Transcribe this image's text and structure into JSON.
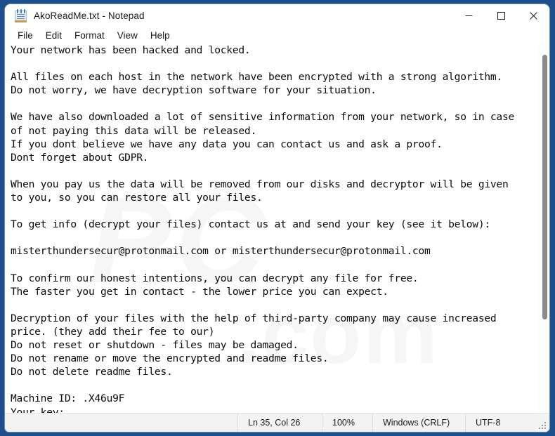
{
  "window": {
    "title": "AkoReadMe.txt - Notepad",
    "icon": "notepad-icon",
    "controls": {
      "minimize": "minimize-icon",
      "maximize": "maximize-icon",
      "close": "close-icon"
    }
  },
  "menu": {
    "items": [
      {
        "label": "File"
      },
      {
        "label": "Edit"
      },
      {
        "label": "Format"
      },
      {
        "label": "View"
      },
      {
        "label": "Help"
      }
    ]
  },
  "document": {
    "filename": "AkoReadMe.txt",
    "body": "Your network has been hacked and locked.\n\nAll files on each host in the network have been encrypted with a strong algorithm.\nDo not worry, we have decryption software for your situation.\n\nWe have also downloaded a lot of sensitive information from your network, so in case\nof not paying this data will be released.\nIf you dont believe we have any data you can contact us and ask a proof.\nDont forget about GDPR.\n\nWhen you pay us the data will be removed from our disks and decryptor will be given\nto you, so you can restore all your files.\n\nTo get info (decrypt your files) contact us at and send your key (see it below):\n\nmisterthundersecur@protonmail.com or misterthundersecur@protonmail.com\n\nTo confirm our honest intentions, you can decrypt any file for free.\nThe faster you get in contact - the lower price you can expect.\n\nDecryption of your files with the help of third-party company may cause increased\nprice. (they add their fee to our)\nDo not reset or shutdown - files may be damaged.\nDo not rename or move the encrypted and readme files.\nDo not delete readme files.\n\nMachine ID: .X46u9F\nYour key:",
    "contact_email": "misterthundersecur@protonmail.com",
    "machine_id": ".X46u9F"
  },
  "watermark": {
    "line1": "PC",
    "line2": ".com"
  },
  "status_bar": {
    "position": "Ln 35, Col 26",
    "zoom": "100%",
    "line_endings": "Windows (CRLF)",
    "encoding": "UTF-8"
  },
  "colors": {
    "desktop": "#1d4f8d",
    "window_bg": "#ffffff",
    "text": "#0b0b0b",
    "status_bg": "#f3f3f3",
    "scroll_thumb": "#8a8a8a"
  }
}
